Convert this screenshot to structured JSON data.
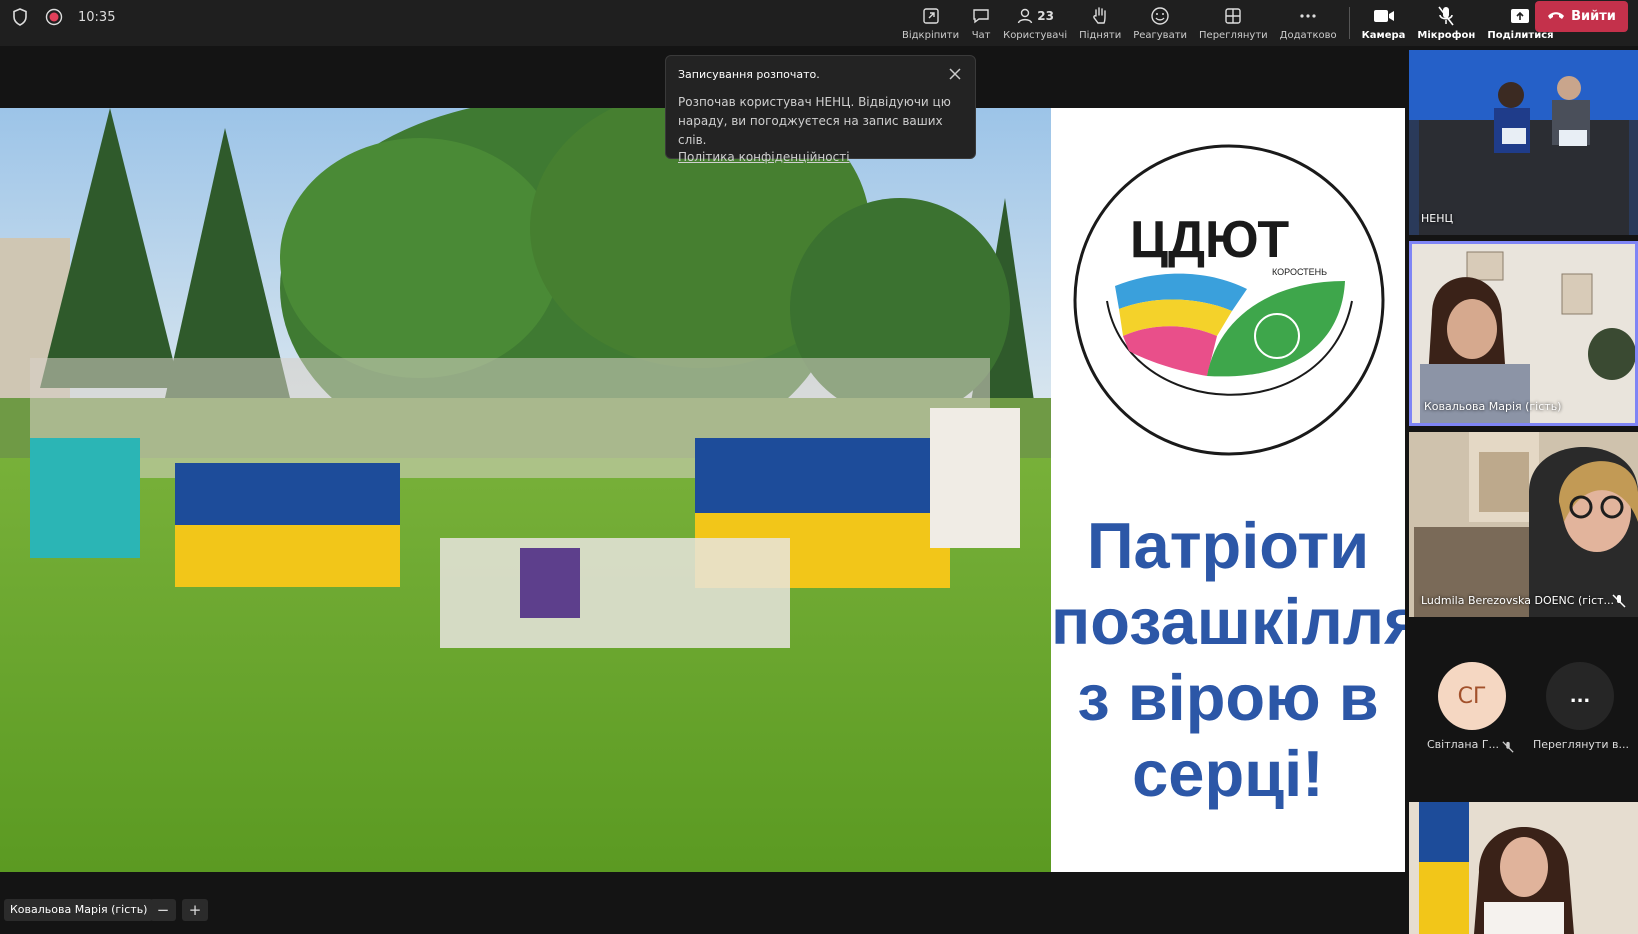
{
  "topbar": {
    "time": "10:35",
    "tools": [
      {
        "name": "unpin",
        "icon": "popout-icon",
        "label": "Відкріпити"
      },
      {
        "name": "chat",
        "icon": "chat-icon",
        "label": "Чат"
      },
      {
        "name": "users",
        "icon": "people-icon",
        "label": "Користувачі",
        "count": "23"
      },
      {
        "name": "raise",
        "icon": "hand-icon",
        "label": "Підняти"
      },
      {
        "name": "react",
        "icon": "smile-icon",
        "label": "Реагувати"
      },
      {
        "name": "view",
        "icon": "layout-icon",
        "label": "Переглянути"
      },
      {
        "name": "more",
        "icon": "more-icon",
        "label": "Додатково"
      }
    ],
    "camera_label": "Камера",
    "mic_label": "Мікрофон",
    "share_label": "Поділитися",
    "leave_label": "Вийти",
    "leave_color": "#c4314b"
  },
  "toast": {
    "title": "Записування розпочато.",
    "body": "Розпочав користувач НЕНЦ. Відвідуючи цю нараду, ви погоджуєтеся на запис ваших слів.",
    "link": "Політика конфіденційності"
  },
  "slide": {
    "logo_text": "ЦДЮТ",
    "logo_city": "КОРОСТЕНЬ",
    "slogan_lines": [
      "Патріоти",
      "позашкілля",
      "з вірою в",
      "серці!"
    ],
    "slogan_color": "#2c57a7"
  },
  "bottom": {
    "speaker_name": "Ковальова Марія (гість)",
    "zoom_out": "−",
    "zoom_in": "+"
  },
  "participants": [
    {
      "name": "НЕНЦ"
    },
    {
      "name": "Ковальова Марія (гість)"
    },
    {
      "name": "Ludmila Berezovska DOENC (гіст..."
    }
  ],
  "avatars": [
    {
      "initials": "СГ",
      "label": "Світлана Г..."
    },
    {
      "initials": "...",
      "label": "Переглянути в..."
    }
  ]
}
